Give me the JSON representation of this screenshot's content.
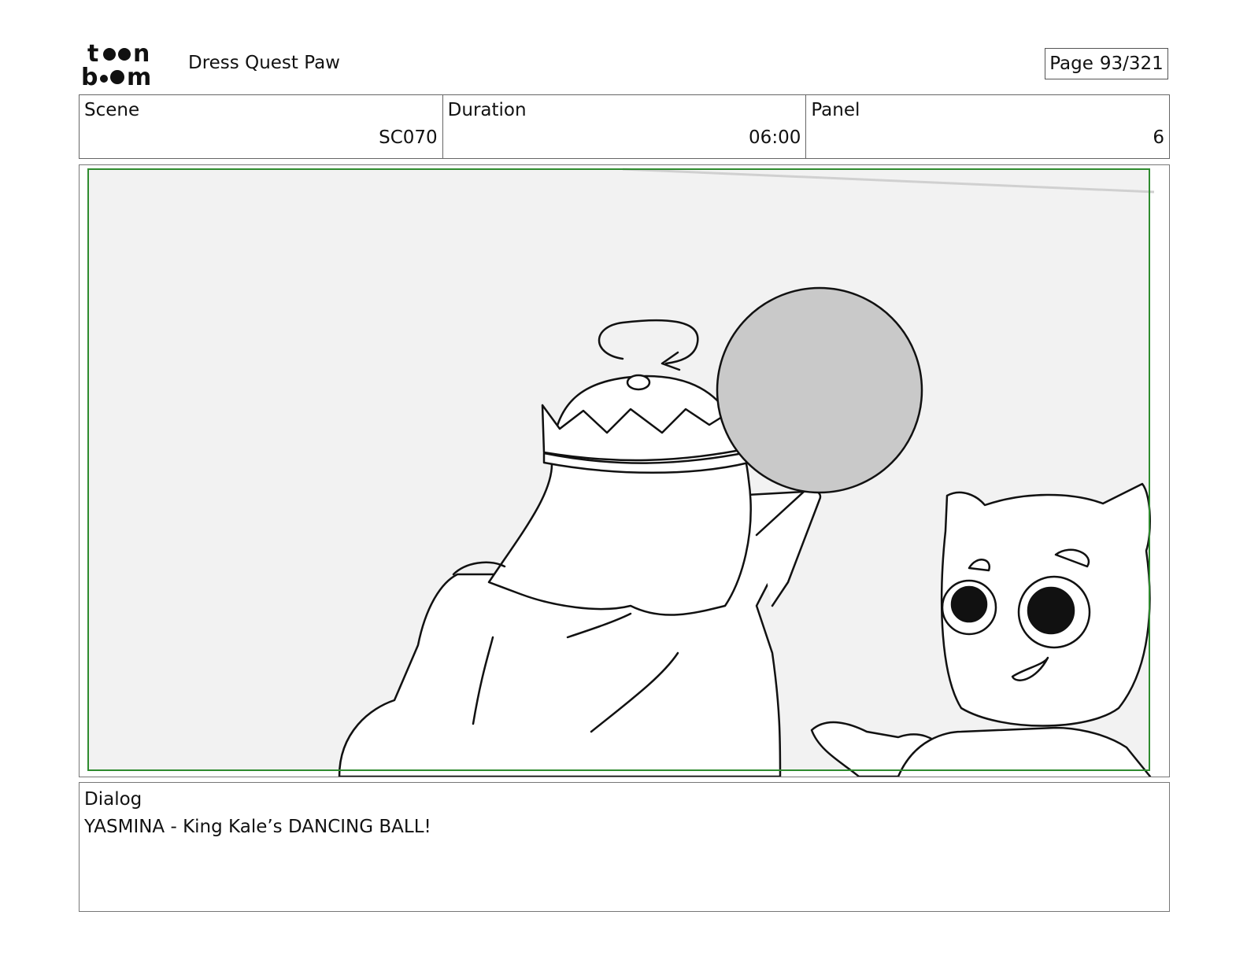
{
  "header": {
    "logo_text": "toon boom",
    "project_title": "Dress Quest Paw",
    "page_label": "Page",
    "page_number": "93/321"
  },
  "info": {
    "scene_label": "Scene",
    "scene_value": "SC070",
    "duration_label": "Duration",
    "duration_value": "06:00",
    "panel_label": "Panel",
    "panel_value": "6"
  },
  "panel": {
    "background_color": "#f2f2f2",
    "safe_frame_color": "#2e8b2e",
    "ball_color": "#c9c9c9"
  },
  "dialog": {
    "label": "Dialog",
    "text": "YASMINA - King Kale’s DANCING BALL!"
  }
}
